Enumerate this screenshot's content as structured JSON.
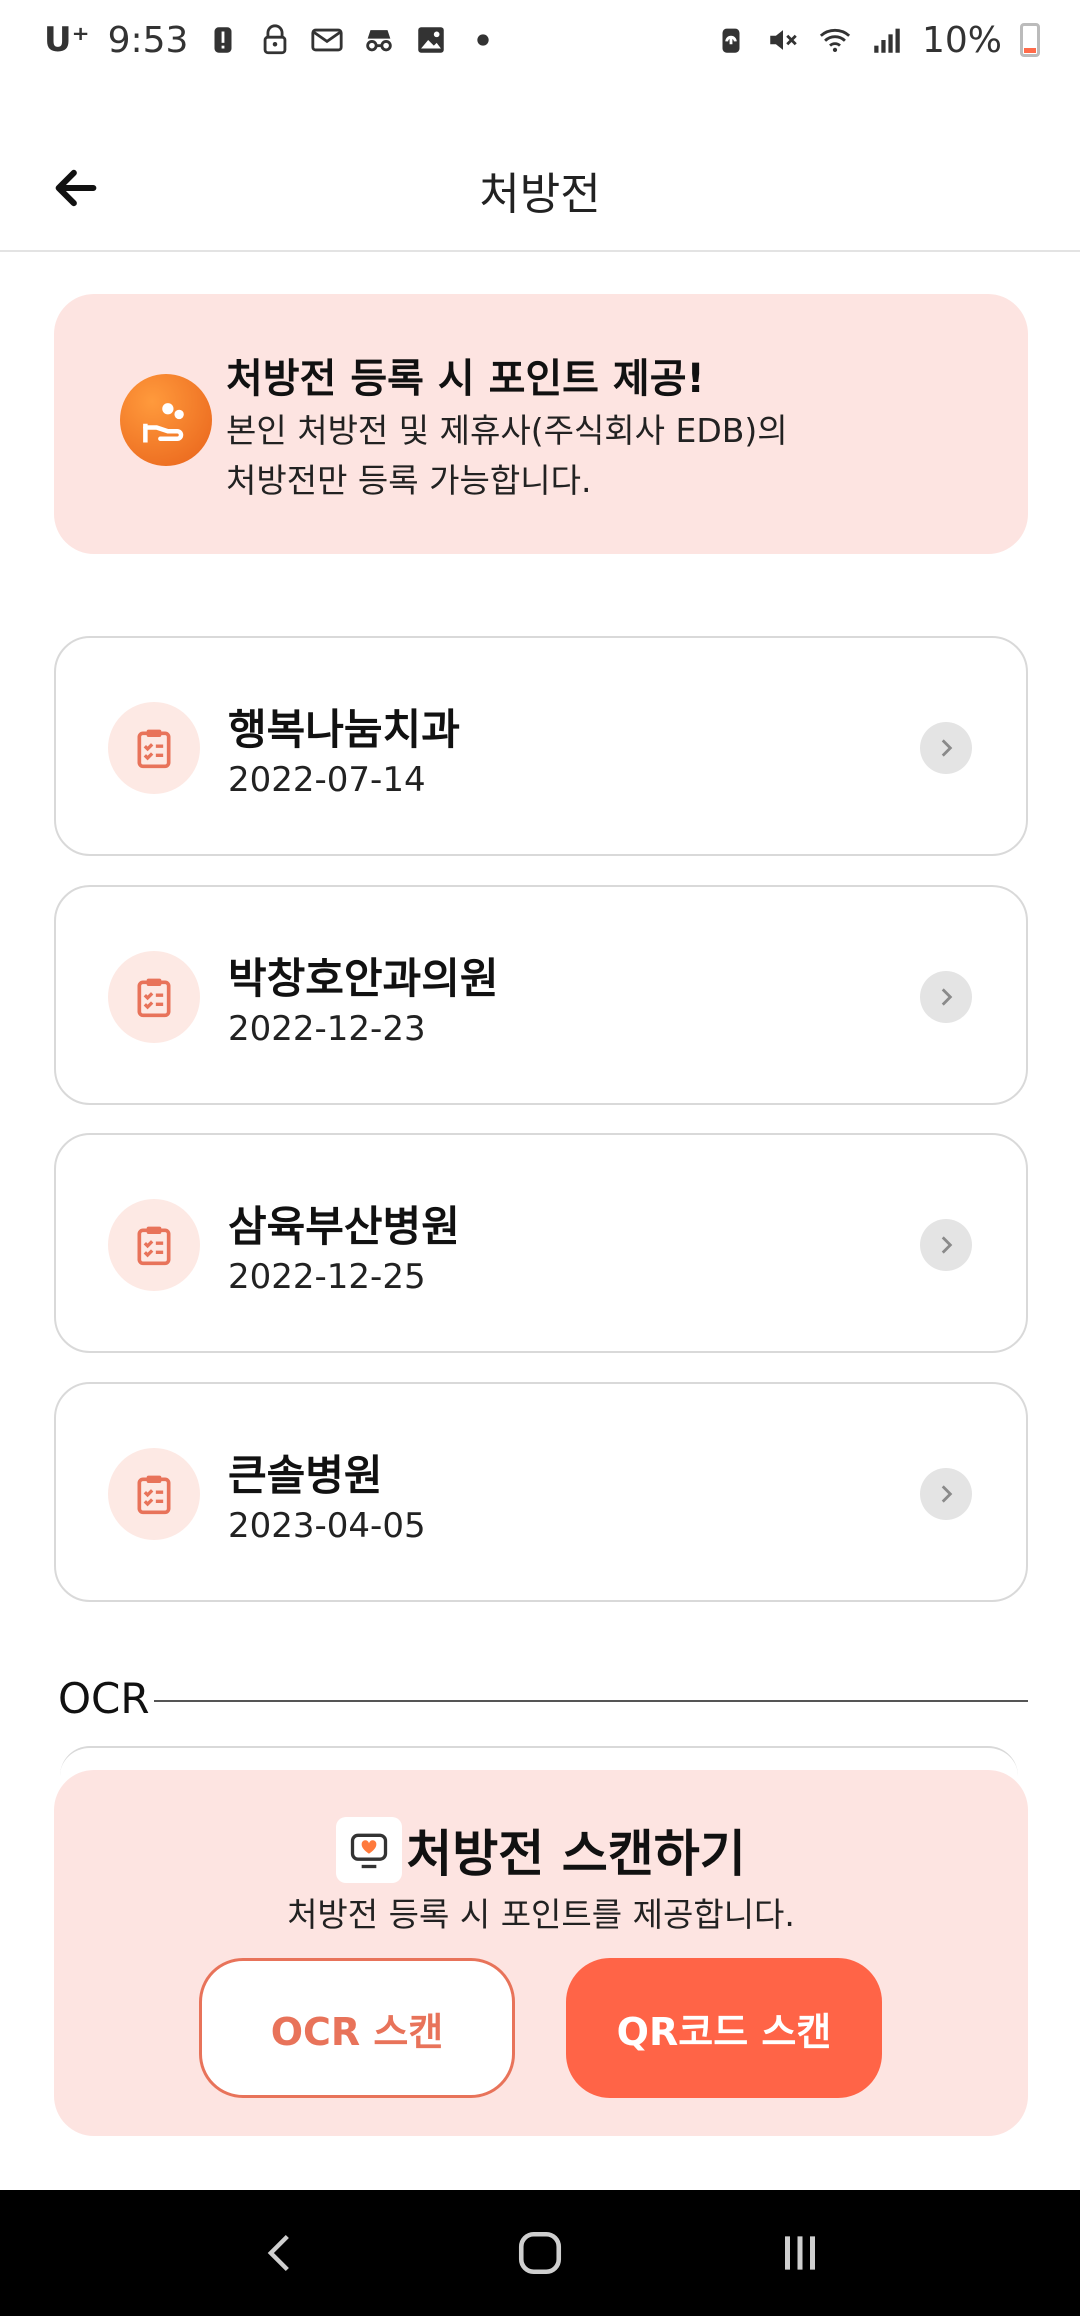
{
  "status_bar": {
    "carrier": "U⁺",
    "time": "9:53",
    "battery": "10%",
    "left_icons": [
      "alert-icon",
      "lock-icon",
      "mail-icon",
      "incognito-icon",
      "image-icon",
      "dot-icon"
    ],
    "right_icons": [
      "battery-saver-icon",
      "mute-icon",
      "wifi-icon",
      "signal-icon"
    ]
  },
  "header": {
    "title": "처방전",
    "back_icon": "back-arrow-icon"
  },
  "promo": {
    "title": "처방전 등록 시 포인트 제공!",
    "desc_line1": "본인 처방전 및 제휴사(주식회사 EDB)의",
    "desc_line2": "처방전만 등록 가능합니다.",
    "icon": "hand-gift-icon"
  },
  "prescriptions": [
    {
      "name": "행복나눔치과",
      "date": "2022-07-14"
    },
    {
      "name": "박창호안과의원",
      "date": "2022-12-23"
    },
    {
      "name": "삼육부산병원",
      "date": "2022-12-25"
    },
    {
      "name": "큰솔병원",
      "date": "2023-04-05"
    }
  ],
  "ocr_section": {
    "label": "OCR"
  },
  "scan_panel": {
    "title": "처방전 스캔하기",
    "subtitle": "처방전 등록 시 포인트를 제공합니다.",
    "ocr_button": "OCR 스캔",
    "qr_button": "QR코드 스캔"
  },
  "colors": {
    "accent": "#ff6447",
    "accent_text": "#e8735a",
    "banner_bg": "#fde4e1"
  }
}
